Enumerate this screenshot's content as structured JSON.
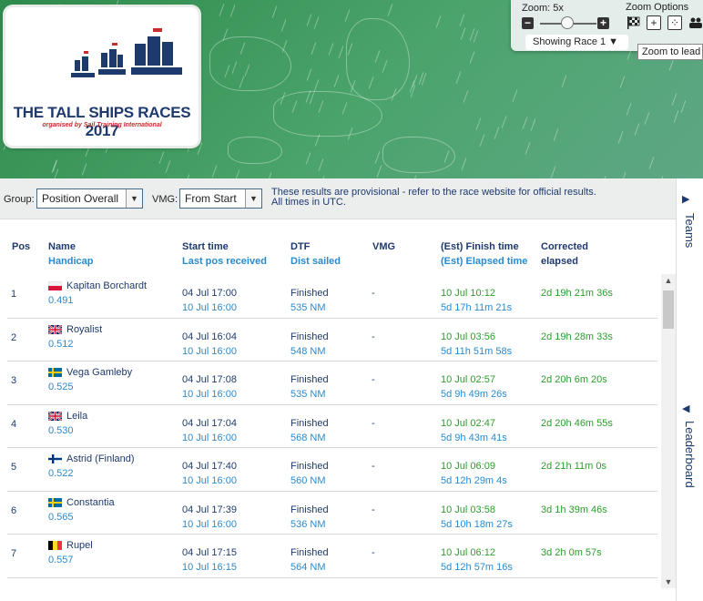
{
  "logo": {
    "title": "THE TALL SHIPS RACES 2017",
    "subtitle": "organised by Sail Training International"
  },
  "zoom": {
    "label": "Zoom: 5x",
    "level": 5,
    "options_label": "Zoom Options",
    "minus": "−",
    "plus": "+",
    "race_select": "Showing Race 1 ▼",
    "tooltip": "Zoom to lead t"
  },
  "filters": {
    "group_label": "Group:",
    "group_value": "Position Overall",
    "vmg_label": "VMG:",
    "vmg_value": "From Start",
    "note_line1": "These results are provisional - refer to the race website for official results.",
    "note_line2": "All times in UTC."
  },
  "headers": {
    "pos": "Pos",
    "name": "Name",
    "handicap": "Handicap",
    "start": "Start time",
    "lastpos": "Last pos received",
    "dtf": "DTF",
    "dist": "Dist sailed",
    "vmg": "VMG",
    "finish": "(Est) Finish time",
    "elapsed": "(Est) Elapsed time",
    "corrected": "Corrected",
    "corrected2": "elapsed"
  },
  "rows": [
    {
      "pos": "1",
      "name": "Kapitan Borchardt",
      "flag": "pl",
      "handicap": "0.491",
      "start": "04 Jul 17:00",
      "lastpos": "10 Jul 16:00",
      "dtf": "Finished",
      "dist": "535 NM",
      "vmg": "-",
      "finish": "10 Jul 10:12",
      "elapsed": "5d 17h 11m 21s",
      "corrected": "2d 19h 21m 36s"
    },
    {
      "pos": "2",
      "name": "Royalist",
      "flag": "gb",
      "handicap": "0.512",
      "start": "04 Jul 16:04",
      "lastpos": "10 Jul 16:00",
      "dtf": "Finished",
      "dist": "548 NM",
      "vmg": "-",
      "finish": "10 Jul 03:56",
      "elapsed": "5d 11h 51m 58s",
      "corrected": "2d 19h 28m 33s"
    },
    {
      "pos": "3",
      "name": "Vega Gamleby",
      "flag": "se",
      "handicap": "0.525",
      "start": "04 Jul 17:08",
      "lastpos": "10 Jul 16:00",
      "dtf": "Finished",
      "dist": "535 NM",
      "vmg": "-",
      "finish": "10 Jul 02:57",
      "elapsed": "5d 9h 49m 26s",
      "corrected": "2d 20h 6m 20s"
    },
    {
      "pos": "4",
      "name": "Leila",
      "flag": "gb",
      "handicap": "0.530",
      "start": "04 Jul 17:04",
      "lastpos": "10 Jul 16:00",
      "dtf": "Finished",
      "dist": "568 NM",
      "vmg": "-",
      "finish": "10 Jul 02:47",
      "elapsed": "5d 9h 43m 41s",
      "corrected": "2d 20h 46m 55s"
    },
    {
      "pos": "5",
      "name": "Astrid (Finland)",
      "flag": "fi",
      "handicap": "0.522",
      "start": "04 Jul 17:40",
      "lastpos": "10 Jul 16:00",
      "dtf": "Finished",
      "dist": "560 NM",
      "vmg": "-",
      "finish": "10 Jul 06:09",
      "elapsed": "5d 12h 29m 4s",
      "corrected": "2d 21h 11m 0s"
    },
    {
      "pos": "6",
      "name": "Constantia",
      "flag": "se",
      "handicap": "0.565",
      "start": "04 Jul 17:39",
      "lastpos": "10 Jul 16:00",
      "dtf": "Finished",
      "dist": "536 NM",
      "vmg": "-",
      "finish": "10 Jul 03:58",
      "elapsed": "5d 10h 18m 27s",
      "corrected": "3d 1h 39m 46s"
    },
    {
      "pos": "7",
      "name": "Rupel",
      "flag": "be",
      "handicap": "0.557",
      "start": "04 Jul 17:15",
      "lastpos": "10 Jul 16:15",
      "dtf": "Finished",
      "dist": "564 NM",
      "vmg": "-",
      "finish": "10 Jul 06:12",
      "elapsed": "5d 12h 57m 16s",
      "corrected": "3d 2h 0m 57s"
    }
  ],
  "tabs": {
    "teams": "Teams",
    "leaderboard": "Leaderboard"
  },
  "colors": {
    "navy": "#1e3a6d",
    "link_blue": "#2a8ad0",
    "corrected_green": "#2c9e2c"
  }
}
